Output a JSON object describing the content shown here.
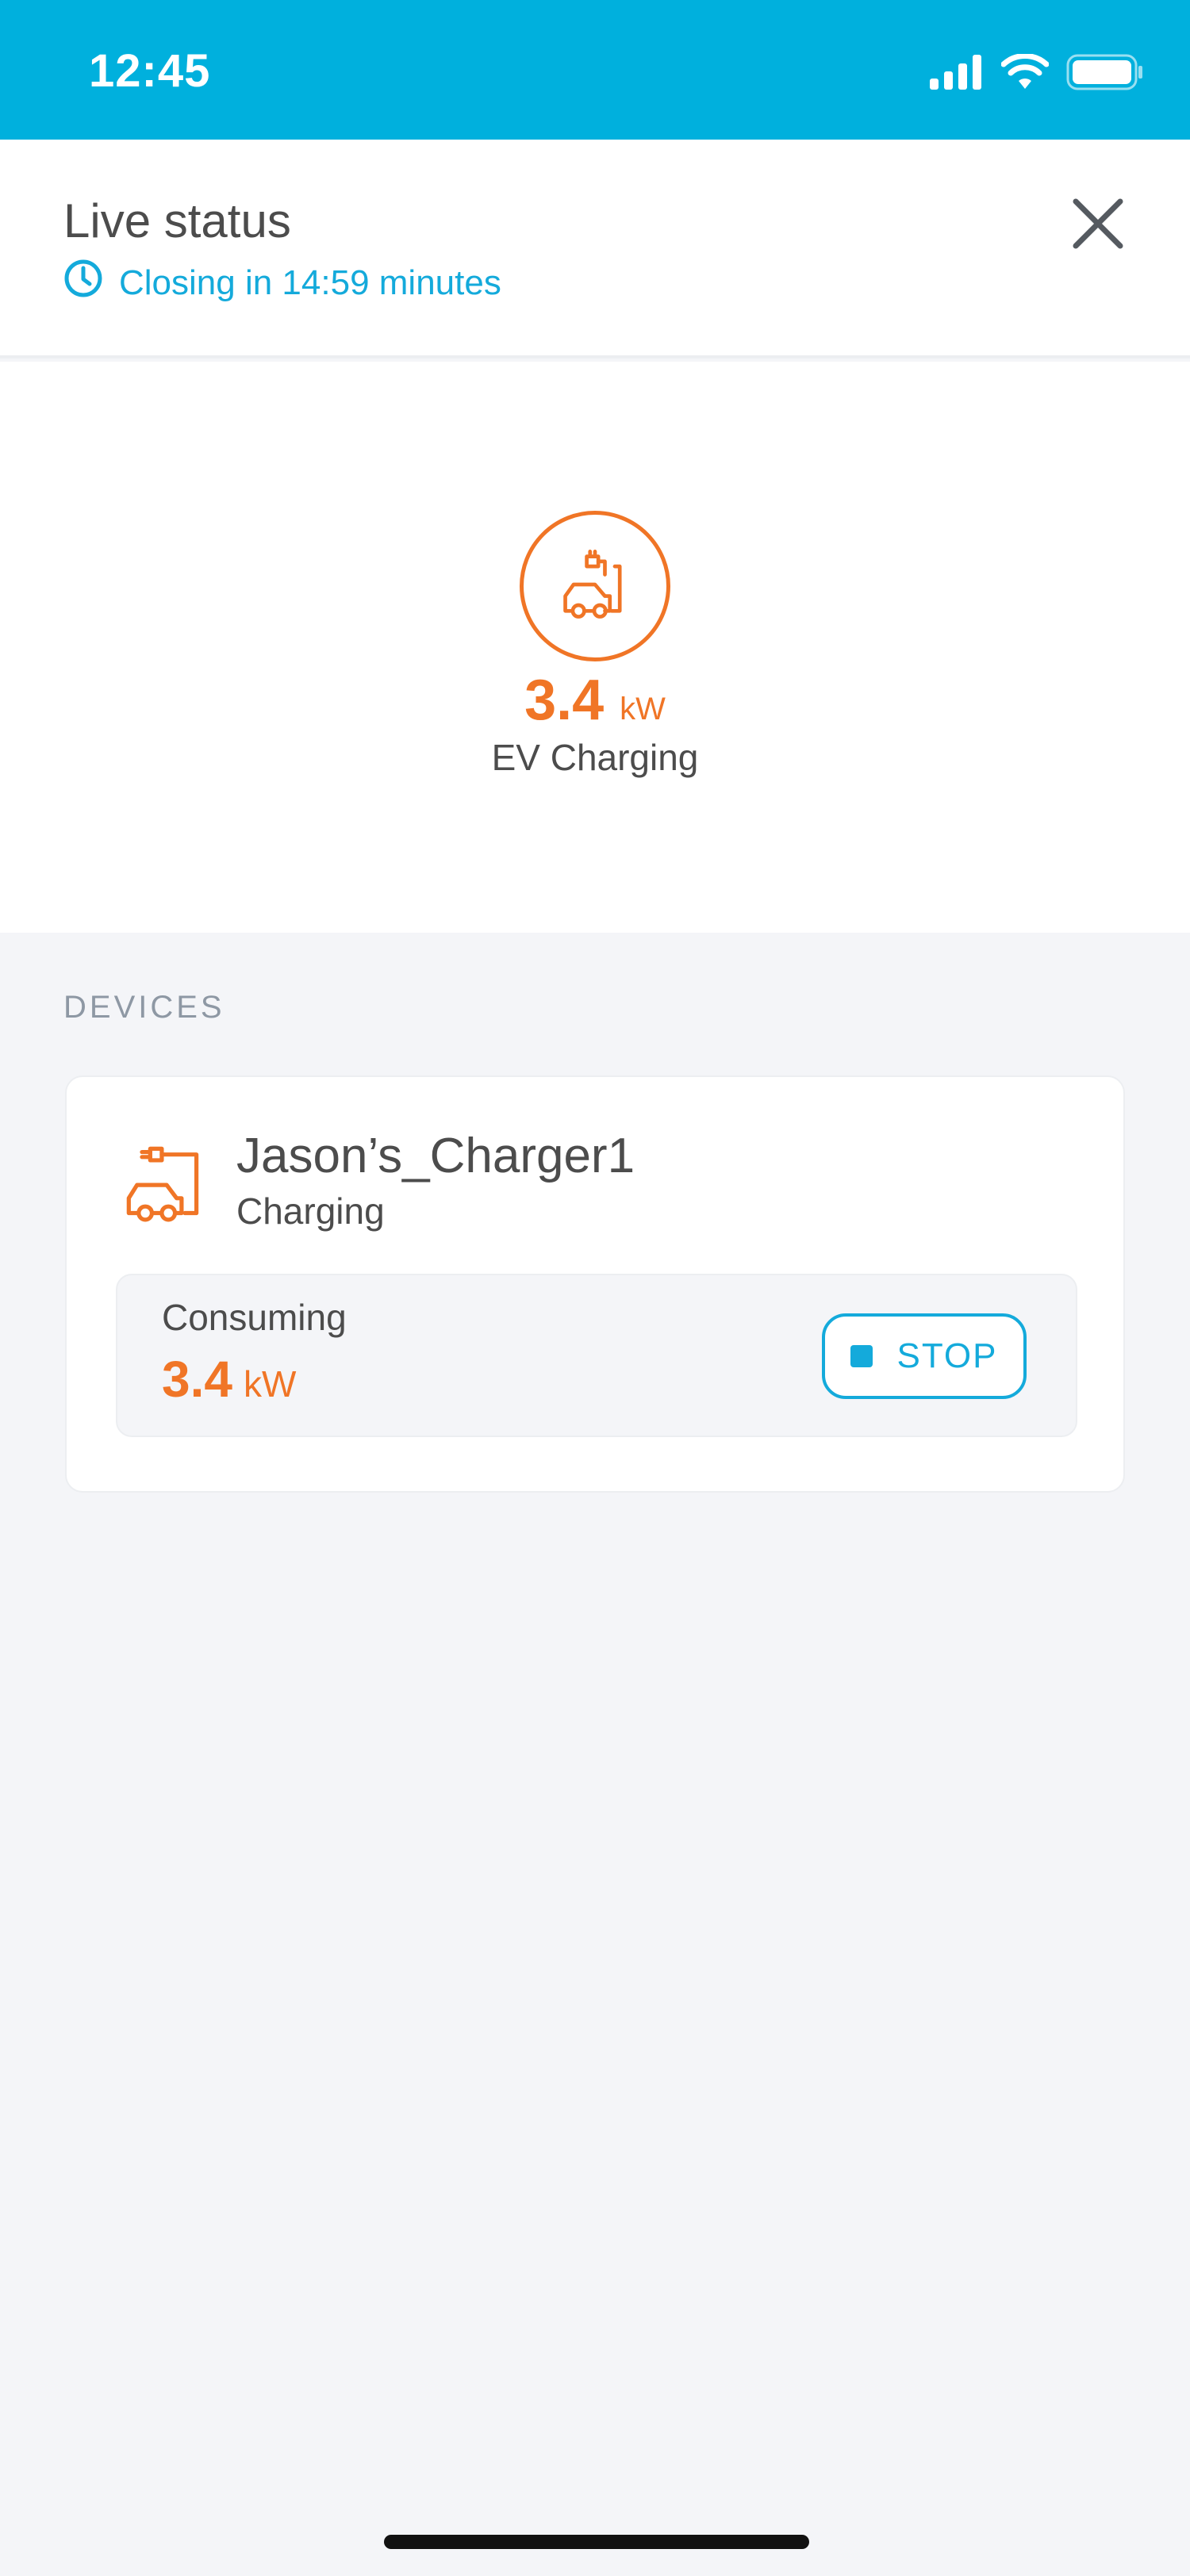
{
  "status_bar": {
    "time": "12:45",
    "icons": [
      "cellular-signal-icon",
      "wifi-icon",
      "battery-icon"
    ]
  },
  "header": {
    "title": "Live status",
    "countdown": "Closing in 14:59 minutes",
    "countdown_icon": "clock-icon",
    "close_icon": "close-icon"
  },
  "hero": {
    "icon": "ev-charging-icon",
    "power_value": "3.4",
    "power_unit": "kW",
    "label": "EV Charging"
  },
  "devices": {
    "section_title": "DEVICES",
    "items": [
      {
        "name": "Jason’s_Charger1",
        "status": "Charging",
        "icon": "ev-charger-icon",
        "consuming_label": "Consuming",
        "consuming_value": "3.4",
        "consuming_unit": "kW",
        "stop_label": "STOP"
      }
    ]
  },
  "colors": {
    "accent": "#00b0dd",
    "link": "#14aadb",
    "energy": "#f07526",
    "text": "#4c4c4c",
    "background": "#f4f5f8"
  }
}
